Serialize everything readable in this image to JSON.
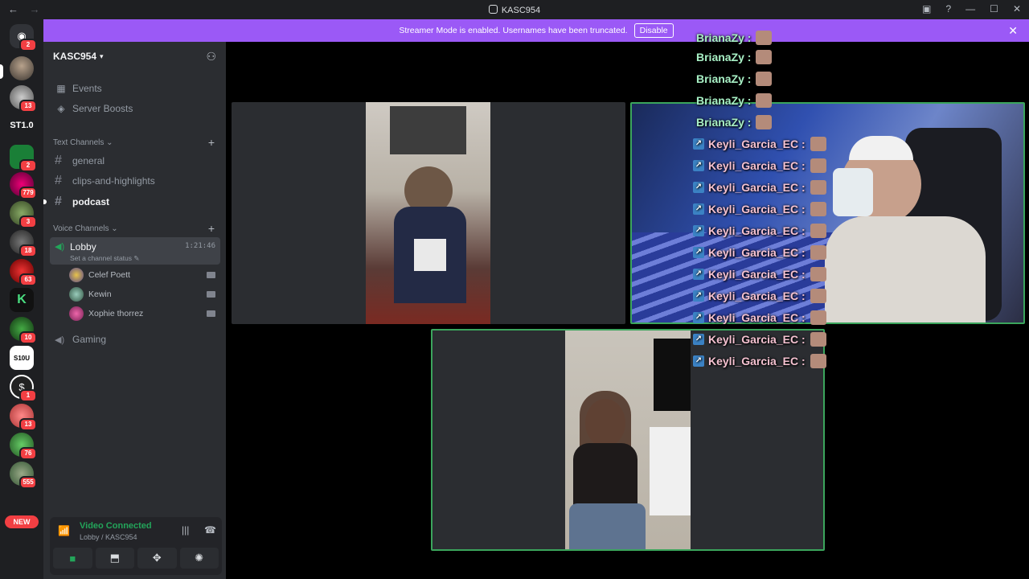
{
  "window": {
    "title": "KASC954"
  },
  "banner": {
    "text": "Streamer Mode is enabled. Usernames have been truncated.",
    "disable_label": "Disable"
  },
  "rail": {
    "home_badge": "2",
    "servers": [
      {
        "badge": ""
      },
      {
        "badge": "13"
      },
      {
        "label": "ST1.0"
      },
      {
        "badge": "2"
      },
      {
        "badge": "779"
      },
      {
        "badge": "3"
      },
      {
        "badge": "18"
      },
      {
        "badge": "63"
      },
      {
        "badge": ""
      },
      {
        "badge": "10"
      },
      {
        "label": "S10U"
      },
      {
        "badge": "1"
      },
      {
        "badge": "13"
      },
      {
        "badge": "76"
      },
      {
        "badge": "555"
      }
    ],
    "new_label": "NEW"
  },
  "guild": {
    "name": "KASC954",
    "events_label": "Events",
    "boosts_label": "Server Boosts",
    "text_category": "Text Channels",
    "voice_category": "Voice Channels",
    "text_channels": [
      "general",
      "clips-and-highlights",
      "podcast"
    ],
    "lobby": {
      "name": "Lobby",
      "time": "1:21:46",
      "status": "Set a channel status"
    },
    "voice_users": [
      "Celef Poett",
      "Kewin",
      "Xophie thorrez"
    ],
    "gaming": "Gaming"
  },
  "panel": {
    "status": "Video Connected",
    "location": "Lobby / KASC954"
  },
  "chat": {
    "lines": [
      {
        "user": "BrianaZy :",
        "kind": "brianazy"
      },
      {
        "user": "BrianaZy :",
        "kind": "brianazy"
      },
      {
        "user": "BrianaZy :",
        "kind": "brianazy"
      },
      {
        "user": "BrianaZy :",
        "kind": "brianazy"
      },
      {
        "user": "BrianaZy :",
        "kind": "brianazy"
      },
      {
        "user": "Keyli_Garcia_EC :",
        "kind": "keyli"
      },
      {
        "user": "Keyli_Garcia_EC :",
        "kind": "keyli"
      },
      {
        "user": "Keyli_Garcia_EC :",
        "kind": "keyli"
      },
      {
        "user": "Keyli_Garcia_EC :",
        "kind": "keyli"
      },
      {
        "user": "Keyli_Garcia_EC :",
        "kind": "keyli"
      },
      {
        "user": "Keyli_Garcia_EC :",
        "kind": "keyli"
      },
      {
        "user": "Keyli_Garcia_EC :",
        "kind": "keyli"
      },
      {
        "user": "Keyli_Garcia_EC :",
        "kind": "keyli"
      },
      {
        "user": "Keyli_Garcia_EC :",
        "kind": "keyli"
      },
      {
        "user": "Keyli_Garcia_EC :",
        "kind": "keyli"
      },
      {
        "user": "Keyli_Garcia_EC :",
        "kind": "keyli"
      }
    ]
  },
  "colors": {
    "banner": "#9b59f6",
    "speaking_border": "#3ba55c",
    "badge": "#f23f43",
    "sidebar": "#2b2d31"
  }
}
